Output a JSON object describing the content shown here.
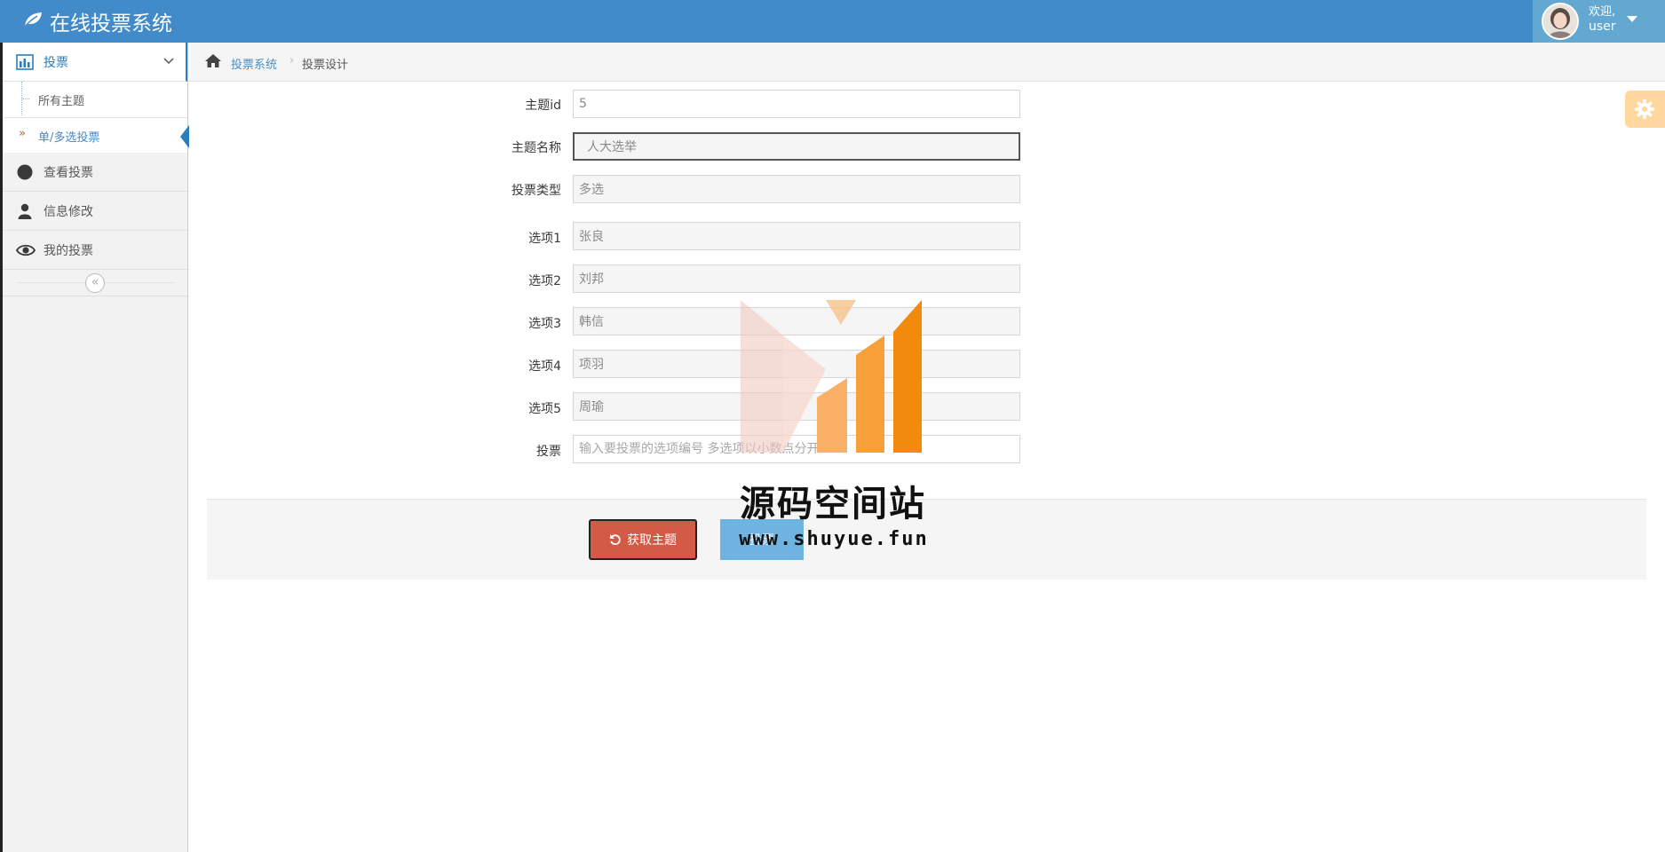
{
  "app": {
    "title": "在线投票系统"
  },
  "user": {
    "greeting": "欢迎,",
    "name": "user"
  },
  "sidebar": {
    "vote_menu": {
      "label": "投票"
    },
    "submenu": [
      {
        "label": "所有主题"
      },
      {
        "label": "单/多选投票"
      }
    ],
    "items": [
      {
        "label": "查看投票",
        "icon": "circle-icon"
      },
      {
        "label": "信息修改",
        "icon": "user-icon"
      },
      {
        "label": "我的投票",
        "icon": "eye-icon"
      }
    ],
    "collapse_glyph": "«"
  },
  "breadcrumb": {
    "root": "投票系统",
    "separator": "›",
    "current": "投票设计"
  },
  "form": {
    "topic_id": {
      "label": "主题id",
      "value": "5"
    },
    "topic_name": {
      "label": "主题名称",
      "value": "人大选举"
    },
    "vote_type": {
      "label": "投票类型",
      "value": "多选"
    },
    "options": [
      {
        "label": "选项1",
        "value": "张良"
      },
      {
        "label": "选项2",
        "value": "刘邦"
      },
      {
        "label": "选项3",
        "value": "韩信"
      },
      {
        "label": "选项4",
        "value": "项羽"
      },
      {
        "label": "选项5",
        "value": "周瑜"
      }
    ],
    "vote": {
      "label": "投票",
      "placeholder": "输入要投票的选项编号 多选项以小数点分开"
    }
  },
  "actions": {
    "fetch_label": "获取主题",
    "submit_label": "投票"
  },
  "watermark": {
    "title": "源码空间站",
    "url": "www.shuyue.fun"
  },
  "colors": {
    "navbar": "#428bca",
    "accent": "#2b7dbc",
    "danger": "#d15b47",
    "primary": "#6fb3e0",
    "settings": "#ffb752"
  }
}
